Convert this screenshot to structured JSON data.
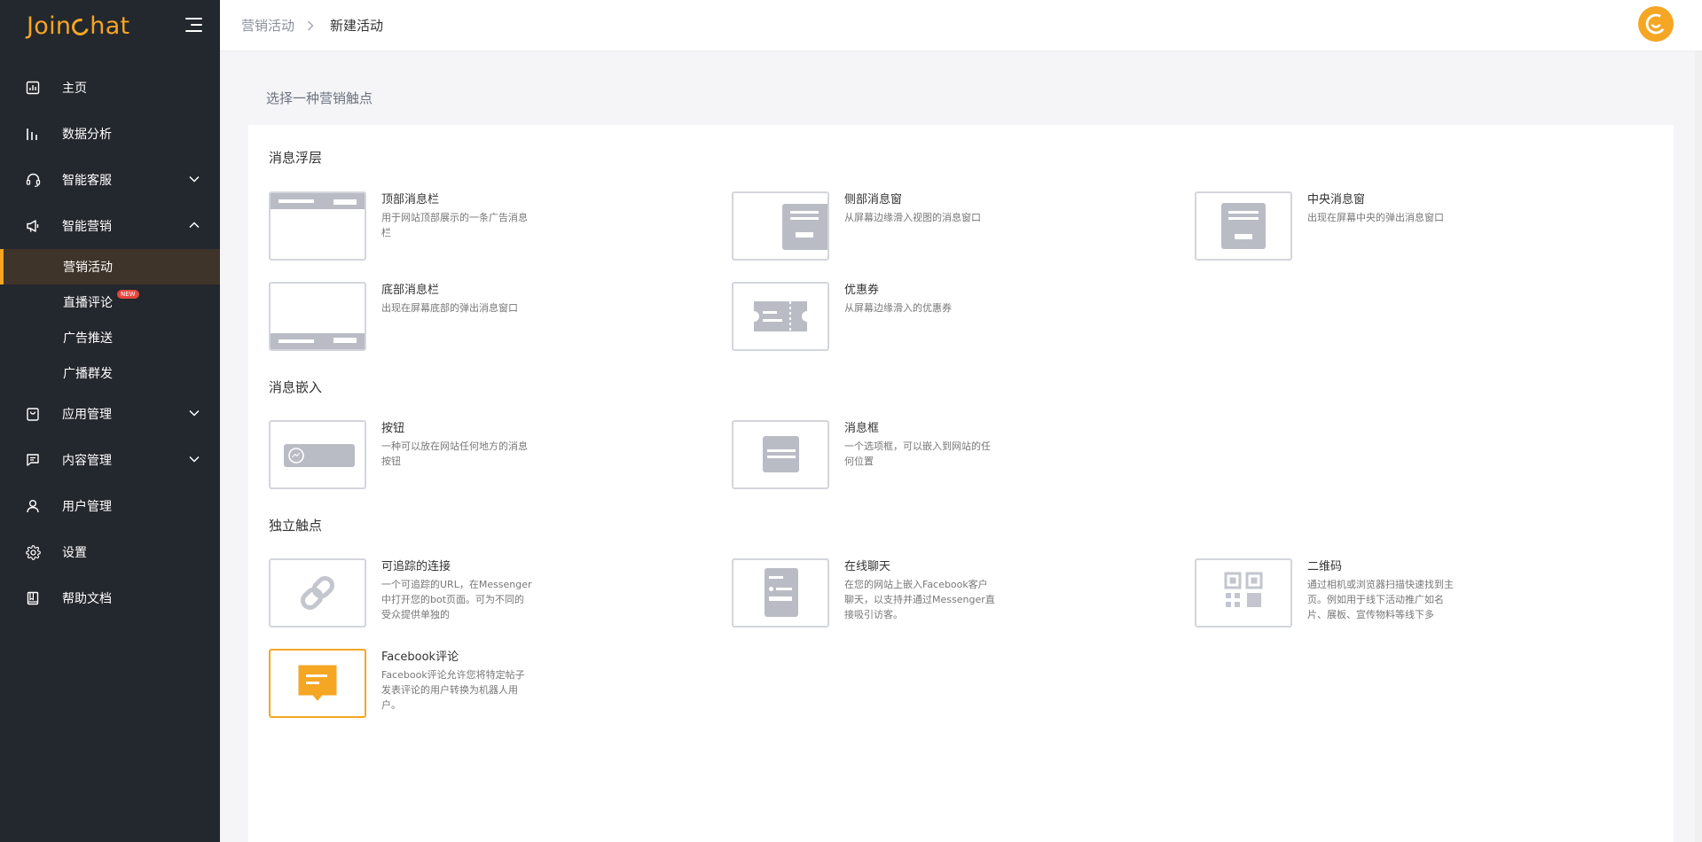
{
  "brand": {
    "logo_pre": "Join",
    "logo_post": "hat",
    "accent": "#f5a623"
  },
  "sidebar": {
    "items": [
      {
        "label": "主页",
        "icon": "dashboard-icon"
      },
      {
        "label": "数据分析",
        "icon": "bar-chart-icon"
      },
      {
        "label": "智能客服",
        "icon": "headset-icon",
        "expandable": true,
        "expanded": false
      },
      {
        "label": "智能营销",
        "icon": "megaphone-icon",
        "expandable": true,
        "expanded": true
      },
      {
        "label": "应用管理",
        "icon": "bag-icon",
        "expandable": true,
        "expanded": false
      },
      {
        "label": "内容管理",
        "icon": "message-square-icon",
        "expandable": true,
        "expanded": false
      },
      {
        "label": "用户管理",
        "icon": "user-icon"
      },
      {
        "label": "设置",
        "icon": "gear-icon"
      },
      {
        "label": "帮助文档",
        "icon": "book-icon"
      }
    ],
    "marketing_sub": [
      {
        "label": "营销活动",
        "active": true
      },
      {
        "label": "直播评论",
        "badge": "NEW"
      },
      {
        "label": "广告推送"
      },
      {
        "label": "广播群发"
      }
    ]
  },
  "header": {
    "breadcrumb_parent": "营销活动",
    "breadcrumb_current": "新建活动"
  },
  "main": {
    "heading": "选择一种营销触点",
    "sections": [
      {
        "title": "消息浮层",
        "cards": [
          {
            "title": "顶部消息栏",
            "desc": "用于网站顶部展示的一条广告消息栏"
          },
          {
            "title": "侧部消息窗",
            "desc": "从屏幕边缘滑入视图的消息窗口"
          },
          {
            "title": "中央消息窗",
            "desc": "出现在屏幕中央的弹出消息窗口"
          },
          {
            "title": "底部消息栏",
            "desc": "出现在屏幕底部的弹出消息窗口"
          },
          {
            "title": "优惠券",
            "desc": "从屏幕边缘滑入的优惠券"
          }
        ]
      },
      {
        "title": "消息嵌入",
        "cards": [
          {
            "title": "按钮",
            "desc": "一种可以放在网站任何地方的消息按钮"
          },
          {
            "title": "消息框",
            "desc": "一个选项框，可以嵌入到网站的任何位置"
          }
        ]
      },
      {
        "title": "独立触点",
        "cards": [
          {
            "title": "可追踪的连接",
            "desc": "一个可追踪的URL，在Messenger中打开您的bot页面。可为不同的受众提供单独的"
          },
          {
            "title": "在线聊天",
            "desc": "在您的网站上嵌入Facebook客户聊天，以支持并通过Messenger直接吸引访客。"
          },
          {
            "title": "二维码",
            "desc": "通过相机或浏览器扫描快速找到主页。例如用于线下活动推广如名片、展板、宣传物料等线下多"
          },
          {
            "title": "Facebook评论",
            "desc": "Facebook评论允许您将特定帖子发表评论的用户转换为机器人用户。",
            "selected": true
          }
        ]
      }
    ]
  }
}
